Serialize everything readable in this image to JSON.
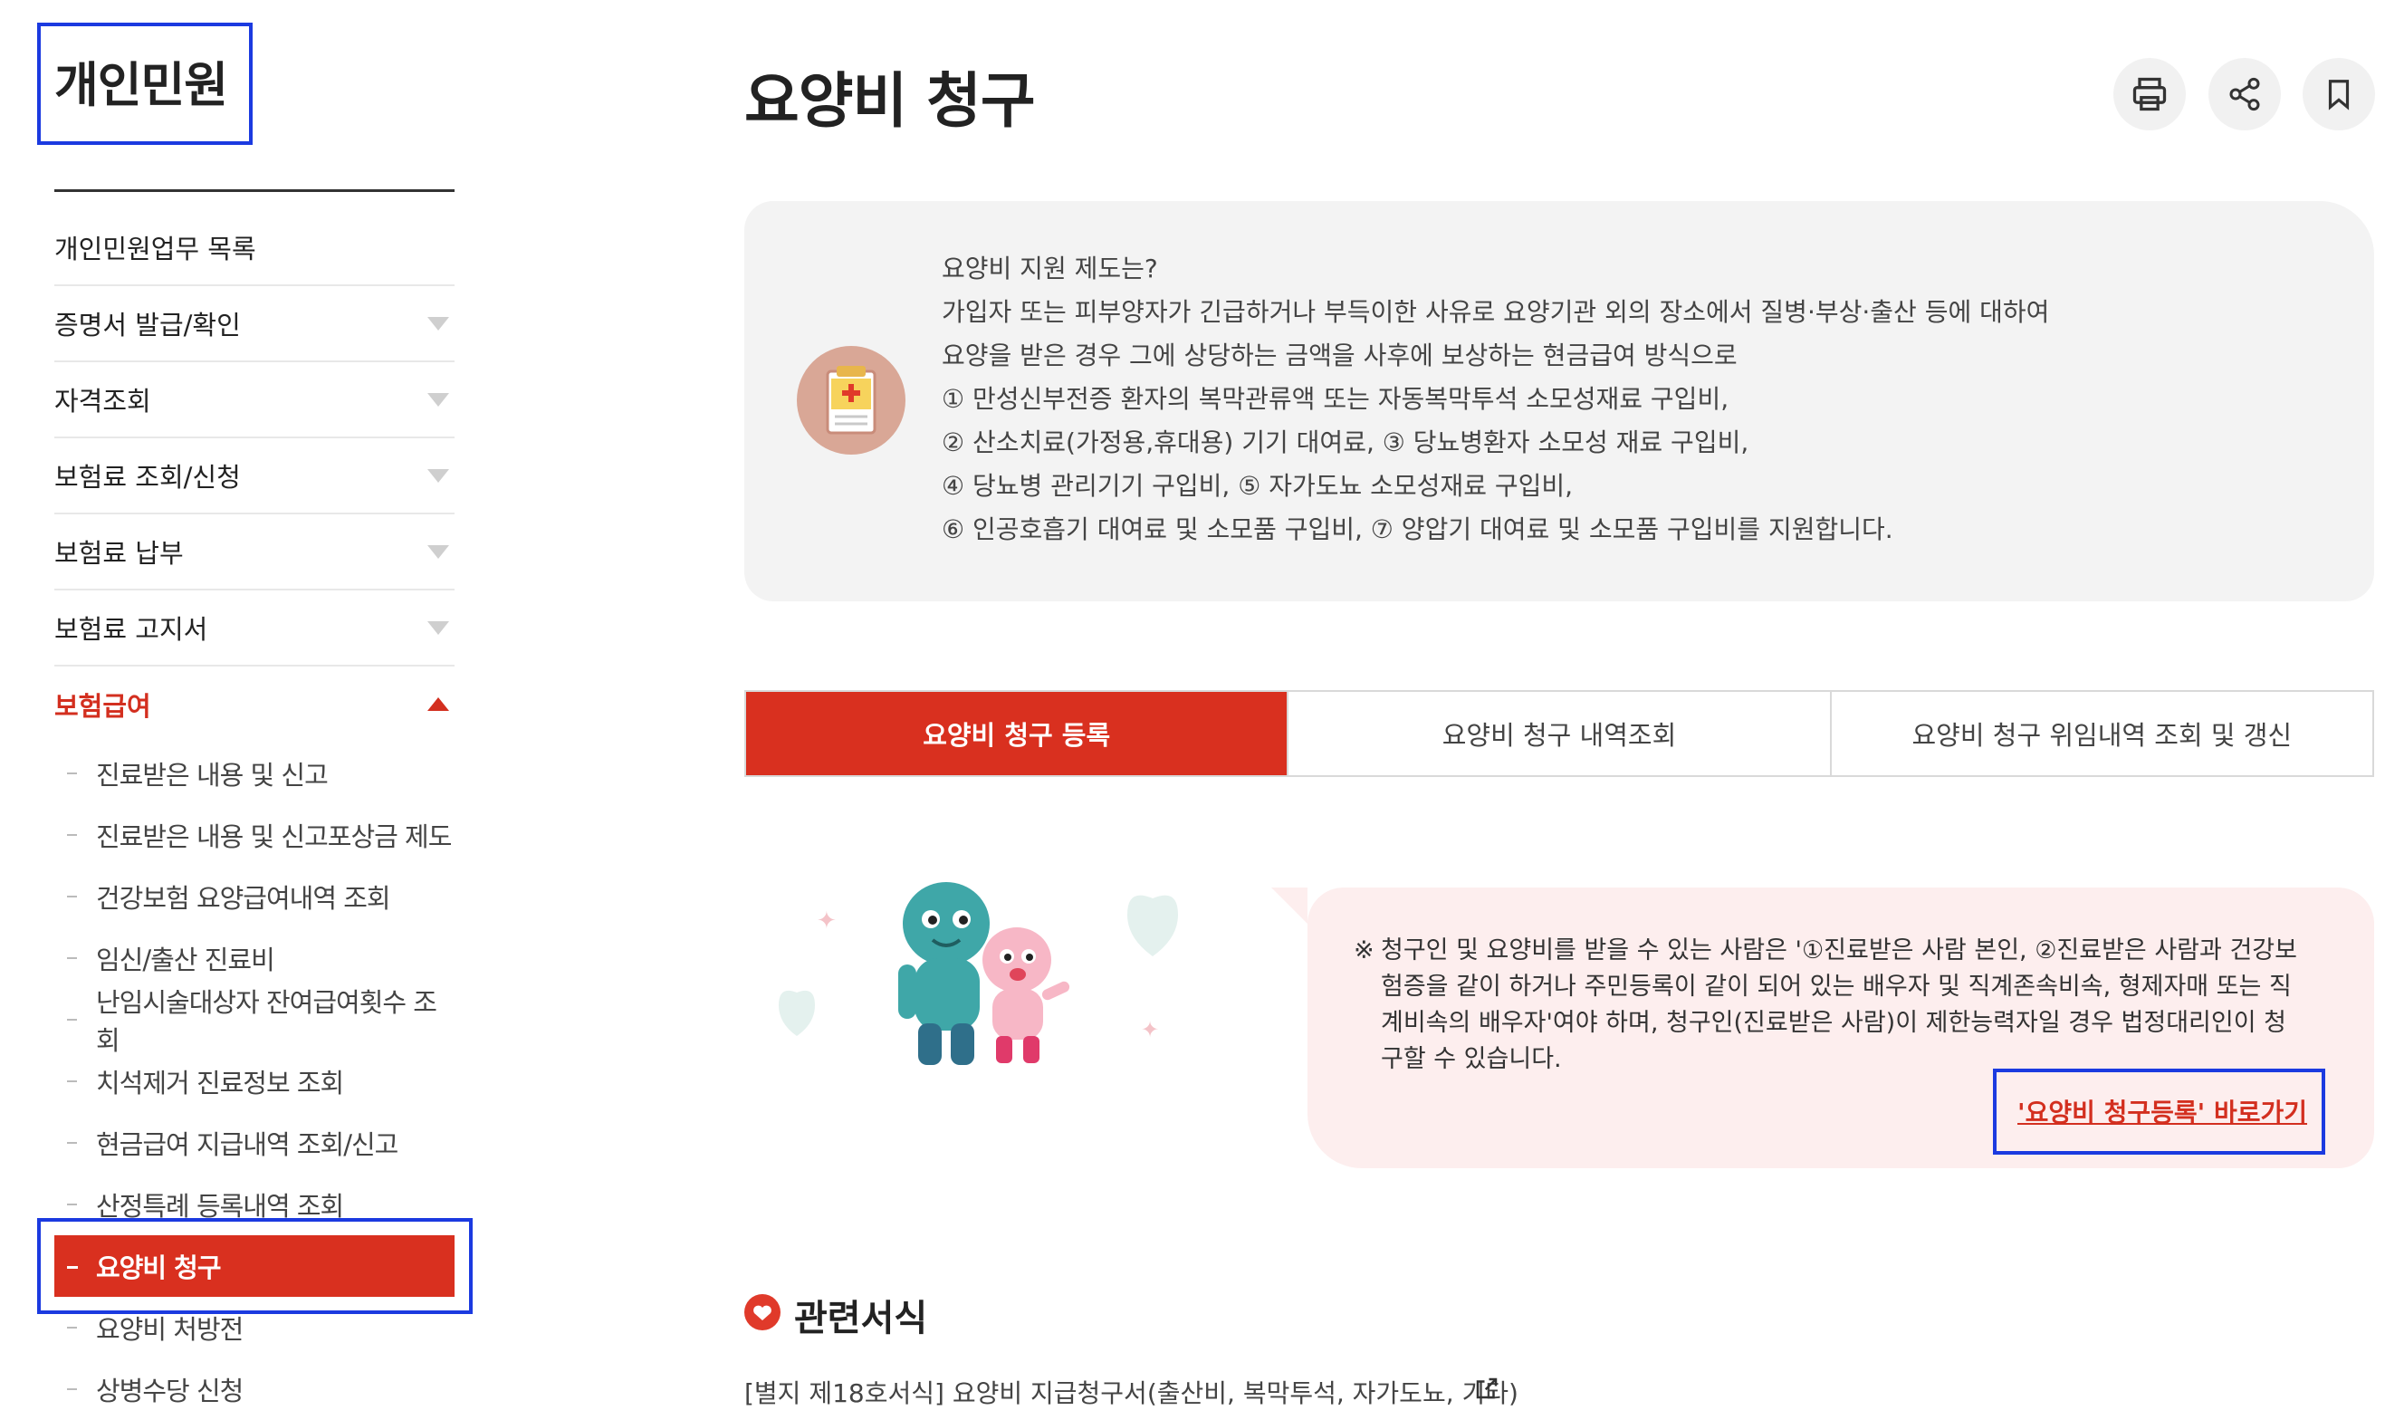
{
  "sidebar": {
    "title": "개인민원",
    "items": [
      {
        "label": "개인민원업무 목록"
      },
      {
        "label": "증명서 발급/확인"
      },
      {
        "label": "자격조회"
      },
      {
        "label": "보험료 조회/신청"
      },
      {
        "label": "보험료 납부"
      },
      {
        "label": "보험료 고지서"
      },
      {
        "label": "보험급여"
      }
    ],
    "sub_items": [
      {
        "label": "진료받은 내용 및 신고"
      },
      {
        "label": "진료받은 내용 및 신고포상금 제도"
      },
      {
        "label": "건강보험 요양급여내역 조회"
      },
      {
        "label": "임신/출산 진료비"
      },
      {
        "label": "난임시술대상자 잔여급여횟수 조회"
      },
      {
        "label": "치석제거 진료정보 조회"
      },
      {
        "label": "현금급여 지급내역 조회/신고"
      },
      {
        "label": "산정특례 등록내역 조회"
      },
      {
        "label": "요양비 청구"
      },
      {
        "label": "요양비 처방전"
      },
      {
        "label": "상병수당 신청"
      }
    ]
  },
  "page": {
    "title": "요양비 청구",
    "actions": {
      "print": "print-icon",
      "share": "share-icon",
      "bookmark": "bookmark-icon"
    }
  },
  "info": {
    "lines": [
      "요양비 지원 제도는?",
      "가입자 또는 피부양자가 긴급하거나 부득이한 사유로 요양기관 외의 장소에서 질병·부상·출산 등에 대하여",
      "요양을 받은 경우 그에 상당하는 금액을 사후에 보상하는 현금급여 방식으로",
      "① 만성신부전증 환자의 복막관류액 또는 자동복막투석 소모성재료 구입비,",
      "② 산소치료(가정용,휴대용) 기기 대여료, ③ 당뇨병환자 소모성 재료 구입비,",
      "④ 당뇨병 관리기기 구입비, ⑤ 자가도뇨 소모성재료 구입비,",
      "⑥ 인공호흡기 대여료 및 소모품 구입비, ⑦ 양압기 대여료 및 소모품 구입비를 지원합니다."
    ]
  },
  "tabs": [
    {
      "label": "요양비 청구 등록"
    },
    {
      "label": "요양비 청구 내역조회"
    },
    {
      "label": "요양비 청구 위임내역 조회 및 갱신"
    }
  ],
  "notice": {
    "mark": "※",
    "text": "청구인 및 요양비를 받을 수 있는 사람은 '①진료받은 사람 본인, ②진료받은 사람과 건강보험증을 같이 하거나 주민등록이 같이 되어 있는 배우자 및 직계존속비속, 형제자매 또는 직계비속의 배우자'여야 하며, 청구인(진료받은 사람)이 제한능력자일 경우 법정대리인이 청구할 수 있습니다.",
    "link": "'요양비 청구등록' 바로가기"
  },
  "forms": {
    "title": "관련서식",
    "items": [
      {
        "label": "[별지 제18호서식] 요양비 지급청구서(출산비, 복막투석, 자가도뇨, 기타)"
      }
    ]
  },
  "colors": {
    "accent": "#d9301f",
    "highlight_box": "#1b3ae0",
    "info_bg": "#f3f3f3",
    "notice_bg": "#fdeeee"
  }
}
